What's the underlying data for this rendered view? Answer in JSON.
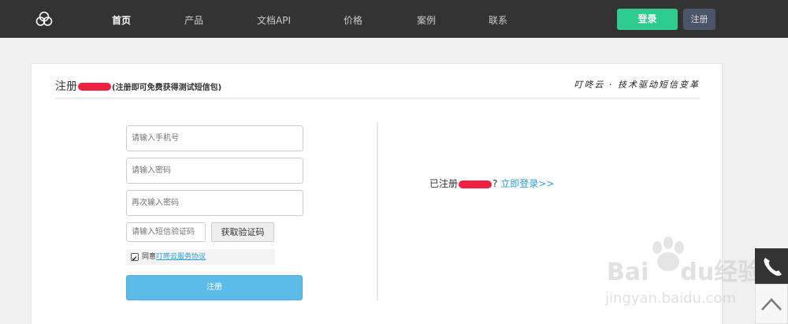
{
  "nav": {
    "items": [
      "首页",
      "产品",
      "文档API",
      "价格",
      "案例",
      "联系"
    ],
    "login": "登录",
    "register": "注册"
  },
  "card": {
    "title": "注册",
    "subtitle": "(注册即可免费获得测试短信包)",
    "slogan": "叮咚云 · 技术驱动短信变革"
  },
  "form": {
    "phone_placeholder": "请输入手机号",
    "password_placeholder": "请输入密码",
    "password_again_placeholder": "再次输入密码",
    "sms_code_placeholder": "请输入短信验证码",
    "get_code": "获取验证码",
    "agree_prefix": "同意",
    "agree_link": "叮咚云服务协议",
    "submit": "注册"
  },
  "right": {
    "already_prefix": "已注册",
    "question": "?",
    "login_link": "立即登录>>"
  },
  "watermark": {
    "brand": "Bai",
    "brand2": "du",
    "suffix": "经验",
    "url": "jingyan.baidu.com"
  }
}
